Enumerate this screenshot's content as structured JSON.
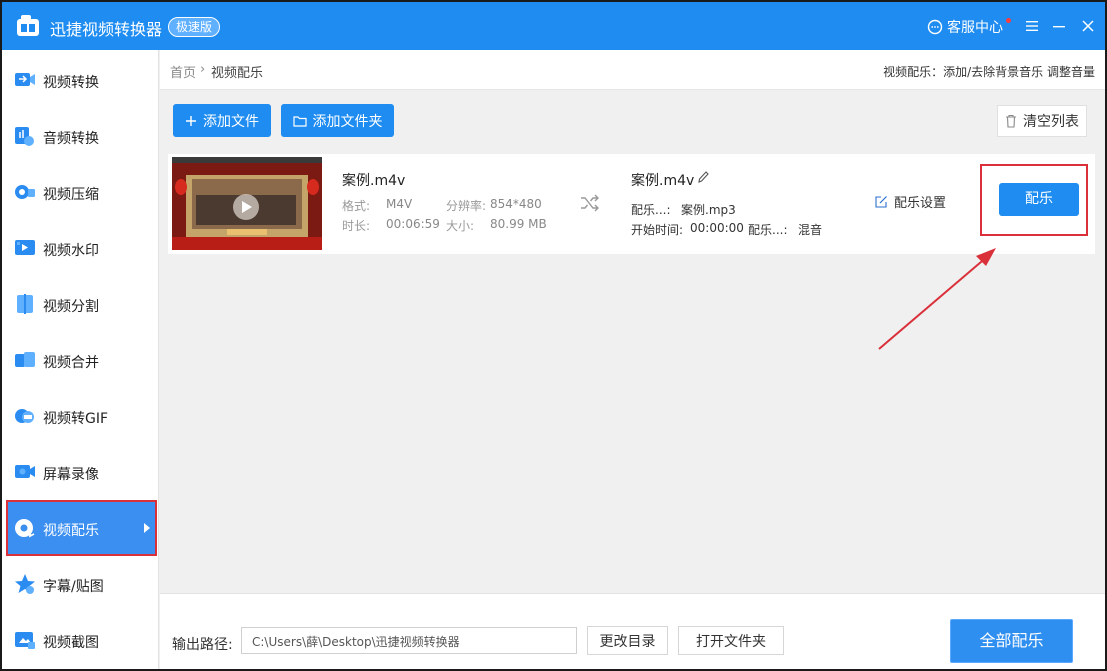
{
  "app": {
    "title": "迅捷视频转换器",
    "edition": "极速版",
    "service_label": "客服中心"
  },
  "sidebar": {
    "items": [
      {
        "label": "视频转换"
      },
      {
        "label": "音频转换"
      },
      {
        "label": "视频压缩"
      },
      {
        "label": "视频水印"
      },
      {
        "label": "视频分割"
      },
      {
        "label": "视频合并"
      },
      {
        "label": "视频转GIF"
      },
      {
        "label": "屏幕录像"
      },
      {
        "label": "视频配乐"
      },
      {
        "label": "字幕/贴图"
      },
      {
        "label": "视频截图"
      }
    ],
    "active_index": 8
  },
  "breadcrumb": {
    "home": "首页",
    "separator": "›",
    "current": "视频配乐",
    "hint": "视频配乐：添加/去除背景音乐 调整音量"
  },
  "toolbar": {
    "add_file": "添加文件",
    "add_folder": "添加文件夹",
    "clear_list": "清空列表"
  },
  "file": {
    "source_name": "案例.m4v",
    "format_key": "格式:",
    "format_val": "M4V",
    "resolution_key": "分辨率:",
    "resolution_val": "854*480",
    "duration_key": "时长:",
    "duration_val": "00:06:59",
    "size_key": "大小:",
    "size_val": "80.99 MB",
    "output_name": "案例.m4v",
    "music_key": "配乐...:",
    "music_val": "案例.mp3",
    "start_key": "开始时间:",
    "start_val": "00:00:00",
    "mode_key": "配乐...:",
    "mode_val": "混音",
    "settings_link": "配乐设置",
    "action_button": "配乐"
  },
  "bottom": {
    "output_label": "输出路径:",
    "output_path": "C:\\Users\\薛\\Desktop\\迅捷视频转换器",
    "change_dir": "更改目录",
    "open_folder": "打开文件夹",
    "all_button": "全部配乐"
  },
  "colors": {
    "primary": "#1e8cf0",
    "highlight": "#d9303a"
  }
}
